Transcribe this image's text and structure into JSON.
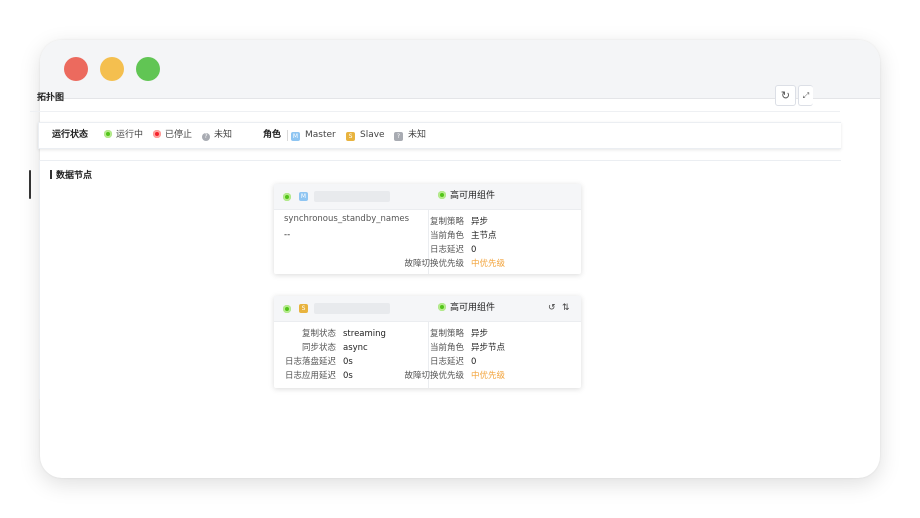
{
  "page": {
    "title": "拓扑图"
  },
  "toolbar": {
    "refresh_icon": "refresh-icon",
    "fullscreen_icon": "fullscreen-icon"
  },
  "legend": {
    "status_title": "运行状态",
    "running": "运行中",
    "stopped": "已停止",
    "unknown": "未知",
    "role_title": "角色",
    "master": "Master",
    "slave": "Slave",
    "role_unknown": "未知",
    "master_badge": "M",
    "slave_badge": "S",
    "unknown_badge": "?",
    "unknown_dot": "?"
  },
  "panel": {
    "title": "数据节点"
  },
  "colors": {
    "running": "#52c41a",
    "stopped": "#f5222d",
    "unknown": "#a8abb2",
    "master": "#8ec5f2",
    "slave": "#e8b33e",
    "priority": "#f2a33a"
  },
  "master_node": {
    "badge": "M",
    "ha_label": "高可用组件",
    "sync_standby_label": "synchronous_standby_names",
    "sync_standby_value": "--",
    "replication_strategy_label": "复制策略",
    "replication_strategy_value": "异步",
    "current_role_label": "当前角色",
    "current_role_value": "主节点",
    "log_delay_label": "日志延迟",
    "log_delay_value": "0",
    "failover_priority_label": "故障切换优先级",
    "failover_priority_value": "中优先级"
  },
  "slave_node": {
    "badge": "S",
    "ha_label": "高可用组件",
    "replication_state_label": "复制状态",
    "replication_state_value": "streaming",
    "sync_state_label": "同步状态",
    "sync_state_value": "async",
    "flush_delay_label": "日志落盘延迟",
    "flush_delay_value": "0s",
    "apply_delay_label": "日志应用延迟",
    "apply_delay_value": "0s",
    "replication_strategy_label": "复制策略",
    "replication_strategy_value": "异步",
    "current_role_label": "当前角色",
    "current_role_value": "异步节点",
    "log_delay_label": "日志延迟",
    "log_delay_value": "0",
    "failover_priority_label": "故障切换优先级",
    "failover_priority_value": "中优先级"
  }
}
